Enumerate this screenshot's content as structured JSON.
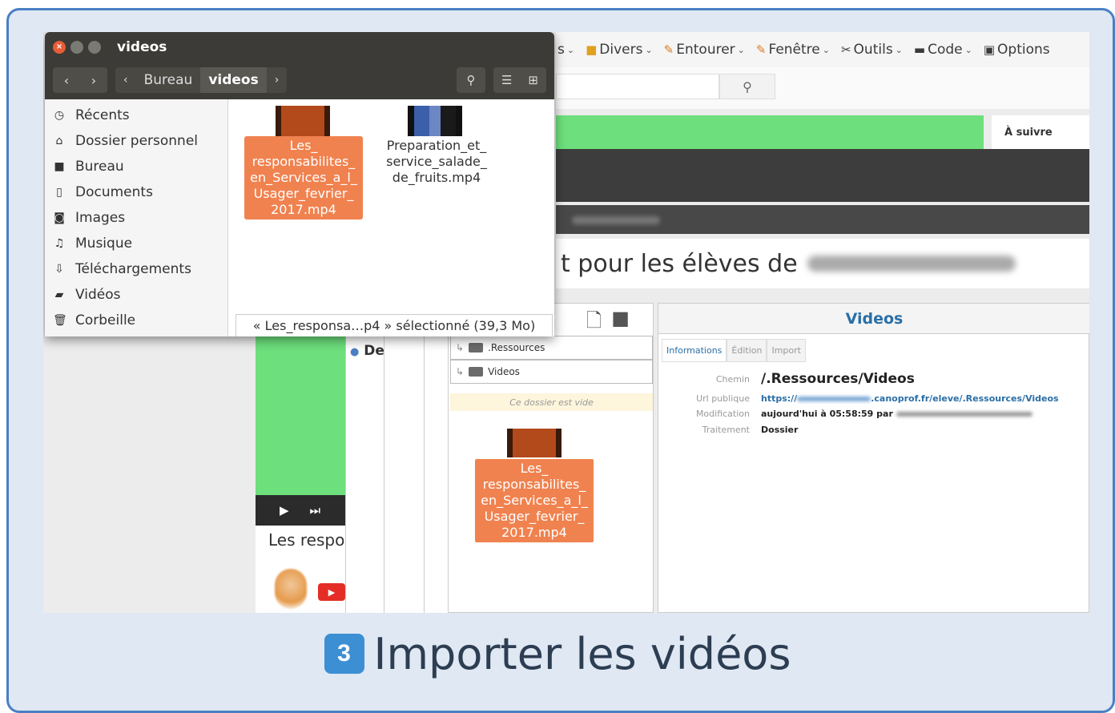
{
  "menubar": {
    "items": [
      {
        "label": "s",
        "icon": "chevron-down-icon"
      },
      {
        "label": "Divers",
        "icon": "folder-icon"
      },
      {
        "label": "Entourer",
        "icon": "pencil-icon"
      },
      {
        "label": "Fenêtre",
        "icon": "pencil-icon"
      },
      {
        "label": "Outils",
        "icon": "tools-icon"
      },
      {
        "label": "Code",
        "icon": "code-icon"
      },
      {
        "label": "Options",
        "icon": "options-icon"
      }
    ]
  },
  "web": {
    "a_suivre": "À suivre",
    "headline": "t pour les élèves de",
    "de_label": "De",
    "video_title": "Les respo"
  },
  "tree": {
    "rows": [
      ".Ressources",
      "Videos"
    ],
    "empty_note": "Ce dossier est vide",
    "drag_label": "Les_\nresponsabilites_\nen_Services_a_l_\nUsager_fevrier_\n2017.mp4"
  },
  "info": {
    "title": "Videos",
    "tabs": [
      "Informations",
      "Édition",
      "Import"
    ],
    "chemin_key": "Chemin",
    "chemin_val": "/.Ressources/Videos",
    "url_key": "Url publique",
    "url_prefix": "https://",
    "url_suffix": ".canoprof.fr/eleve/.Ressources/Videos",
    "modif_key": "Modification",
    "modif_val": "aujourd'hui à 05:58:59 par",
    "trait_key": "Traitement",
    "trait_val": "Dossier"
  },
  "file_manager": {
    "title": "videos",
    "crumbs": [
      "Bureau",
      "videos"
    ],
    "sidebar": [
      {
        "label": "Récents",
        "icon": "clock-icon"
      },
      {
        "label": "Dossier personnel",
        "icon": "home-icon"
      },
      {
        "label": "Bureau",
        "icon": "folder-icon"
      },
      {
        "label": "Documents",
        "icon": "document-icon"
      },
      {
        "label": "Images",
        "icon": "camera-icon"
      },
      {
        "label": "Musique",
        "icon": "music-icon"
      },
      {
        "label": "Téléchargements",
        "icon": "download-icon"
      },
      {
        "label": "Vidéos",
        "icon": "video-icon"
      },
      {
        "label": "Corbeille",
        "icon": "trash-icon"
      }
    ],
    "files": [
      {
        "name": "Les_\nresponsabilites_\nen_Services_a_l_\nUsager_fevrier_\n2017.mp4",
        "selected": true
      },
      {
        "name": "Preparation_et_\nservice_salade_\nde_fruits.mp4",
        "selected": false
      }
    ],
    "status": "« Les_responsa…p4 » sélectionné  (39,3 Mo)"
  },
  "caption": {
    "step": "3",
    "text": "Importer les vidéos"
  },
  "colors": {
    "accent": "#4a7fc4",
    "selection": "#f0824f",
    "green": "#6ddf7c"
  }
}
